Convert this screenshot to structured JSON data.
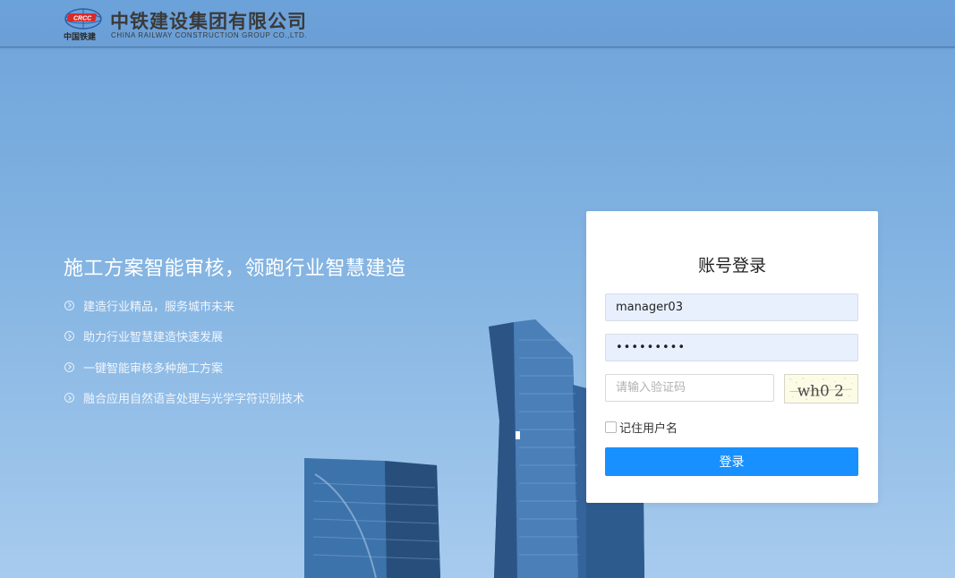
{
  "header": {
    "logo_label": "中国铁建",
    "logo_badge": "CRCC",
    "company_name_cn": "中铁建设集团有限公司",
    "company_name_en": "CHINA RAILWAY CONSTRUCTION GROUP CO.,LTD."
  },
  "hero": {
    "title": "施工方案智能审核，领跑行业智慧建造",
    "features": [
      "建造行业精品，服务城市未来",
      "助力行业智慧建造快速发展",
      "一键智能审核多种施工方案",
      "融合应用自然语言处理与光学字符识别技术"
    ]
  },
  "login": {
    "title": "账号登录",
    "username_value": "manager03",
    "password_value": "•••••••••",
    "captcha_placeholder": "请输入验证码",
    "captcha_text": "wh0 2",
    "remember_label": "记住用户名",
    "submit_label": "登录"
  },
  "colors": {
    "header_bg": "#6ca2da",
    "primary_button": "#1890ff",
    "input_autofill_bg": "#e8f0fe"
  }
}
